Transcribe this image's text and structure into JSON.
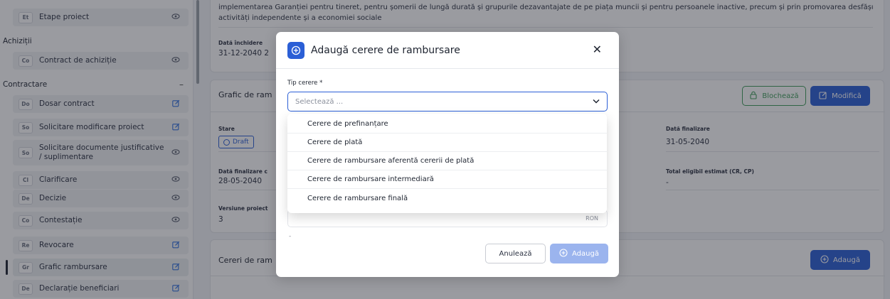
{
  "sidebar": {
    "items_top": [
      {
        "abbr": "Et",
        "label": "Etape proiect",
        "icon": "eye-icon"
      }
    ],
    "groups": [
      {
        "label": "Achiziții",
        "collapse": ""
      },
      {
        "label": "Contractare",
        "collapse": "–"
      }
    ],
    "achizitii_items": [
      {
        "abbr": "Co",
        "label": "Contract de achiziție",
        "icon": "eye-icon"
      }
    ],
    "contractare_items": [
      {
        "abbr": "Do",
        "label": "Dosar contract",
        "icon": "edit-icon"
      },
      {
        "abbr": "So",
        "label": "Solicitare modificare proiect",
        "icon": "edit-icon"
      },
      {
        "abbr": "So",
        "label": "Solicitare documente justificative / suplimentare",
        "icon": "eye-icon"
      },
      {
        "abbr": "Cl",
        "label": "Clarificare",
        "icon": "eye-icon"
      },
      {
        "abbr": "De",
        "label": "Decizie",
        "icon": "eye-icon"
      },
      {
        "abbr": "Co",
        "label": "Contestație",
        "icon": "eye-icon"
      },
      {
        "abbr": "Re",
        "label": "Revocare",
        "icon": "edit-icon"
      },
      {
        "abbr": "Gr",
        "label": "Grafic rambursare",
        "icon": "edit-icon"
      },
      {
        "abbr": "De",
        "label": "Declarație beneficiari",
        "icon": "edit-icon"
      }
    ]
  },
  "main": {
    "top_text_line1": "implementarea Garanției pentru tineret, pentru șomerii de lungă durată și grupurile dezavantajate de pe piața muncii și pentru persoanele inactive, precum și prin promovarea desfășurării de",
    "top_text_line2": "activități independente și a economiei sociale",
    "close_date_label": "Dată închidere",
    "close_date_value": "31-12-2040 2",
    "grafic_title": "Grafic de ram",
    "lock_button": "Blochează",
    "edit_button": "Modifică",
    "stare_label": "Stare",
    "stare_value": "Draft",
    "finalizare_label": "Dată finalizare",
    "finalizare_value": "31-05-2040",
    "finalizare2_label": "Dată finalizare c",
    "finalizare2_value": "28-05-2040",
    "total_label": "Total eligibil estimat (CR, CP)",
    "total_value": "-",
    "versiune_label": "Versiune proiect",
    "versiune_value": "3",
    "cereri_title": "Cereri de ram",
    "add_button": "Adaugă"
  },
  "modal": {
    "title": "Adaugă cerere de rambursare",
    "close_glyph": "✕",
    "field_label": "Tip cerere *",
    "placeholder": "Selectează ...",
    "currency": "RON",
    "dash": "-",
    "cancel": "Anulează",
    "add": "Adaugă",
    "options": [
      "Cerere de prefinanțare",
      "Cerere de plată",
      "Cerere de rambursare aferentă cererii de plată",
      "Cerere de rambursare intermediară",
      "Cerere de rambursare finală"
    ]
  },
  "colors": {
    "primary": "#2b5fd6",
    "primary_disabled": "#9bb4ee",
    "success": "#3f9d5a"
  }
}
